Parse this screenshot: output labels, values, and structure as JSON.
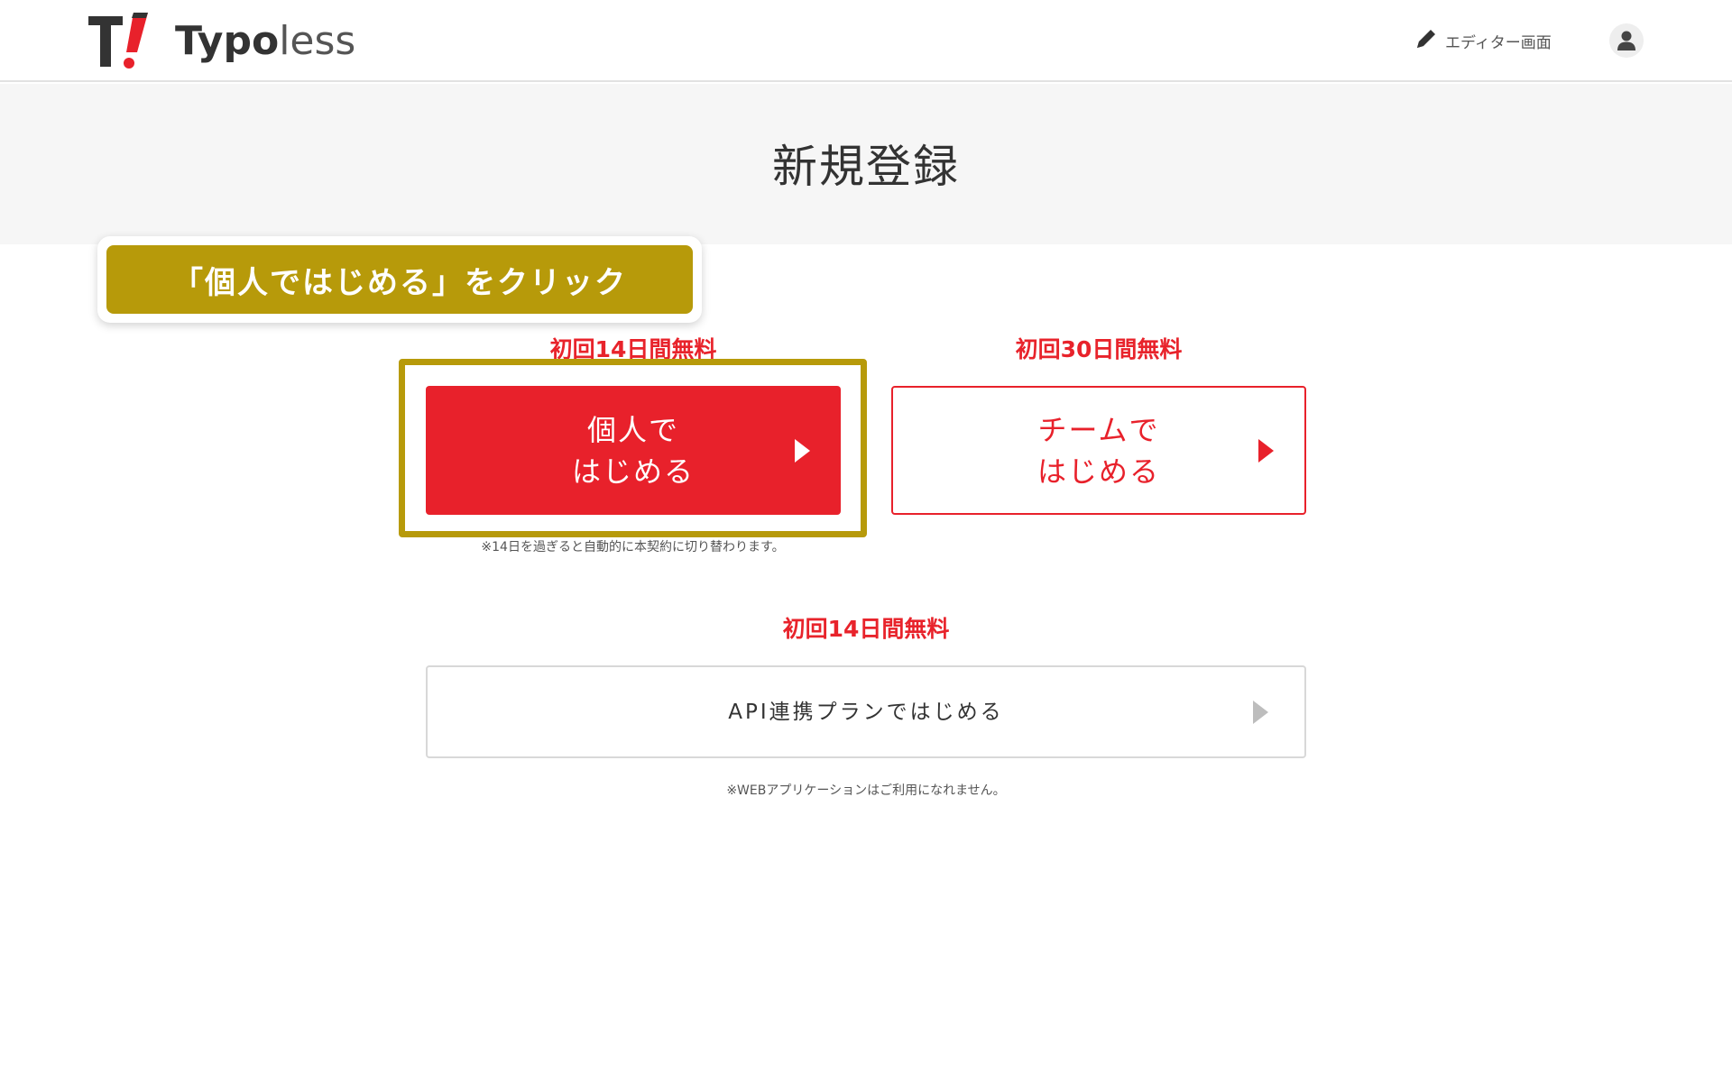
{
  "header": {
    "logo_text_bold": "Typo",
    "logo_text_light": "less",
    "editor_link_label": "エディター画面"
  },
  "page": {
    "title": "新規登録"
  },
  "callout": {
    "text": "「個人ではじめる」をクリック"
  },
  "plans": {
    "personal": {
      "trial": "初回14日間無料",
      "line1": "個人で",
      "line2": "はじめる",
      "note": "※14日を過ぎると自動的に本契約に切り替わります。"
    },
    "team": {
      "trial": "初回30日間無料",
      "line1": "チームで",
      "line2": "はじめる"
    },
    "api": {
      "trial": "初回14日間無料",
      "label": "API連携プランではじめる",
      "note": "※WEBアプリケーションはご利用になれません。"
    }
  },
  "colors": {
    "brand_red": "#e8212b",
    "callout_gold": "#b79a0a",
    "title_band": "#f6f6f6"
  }
}
